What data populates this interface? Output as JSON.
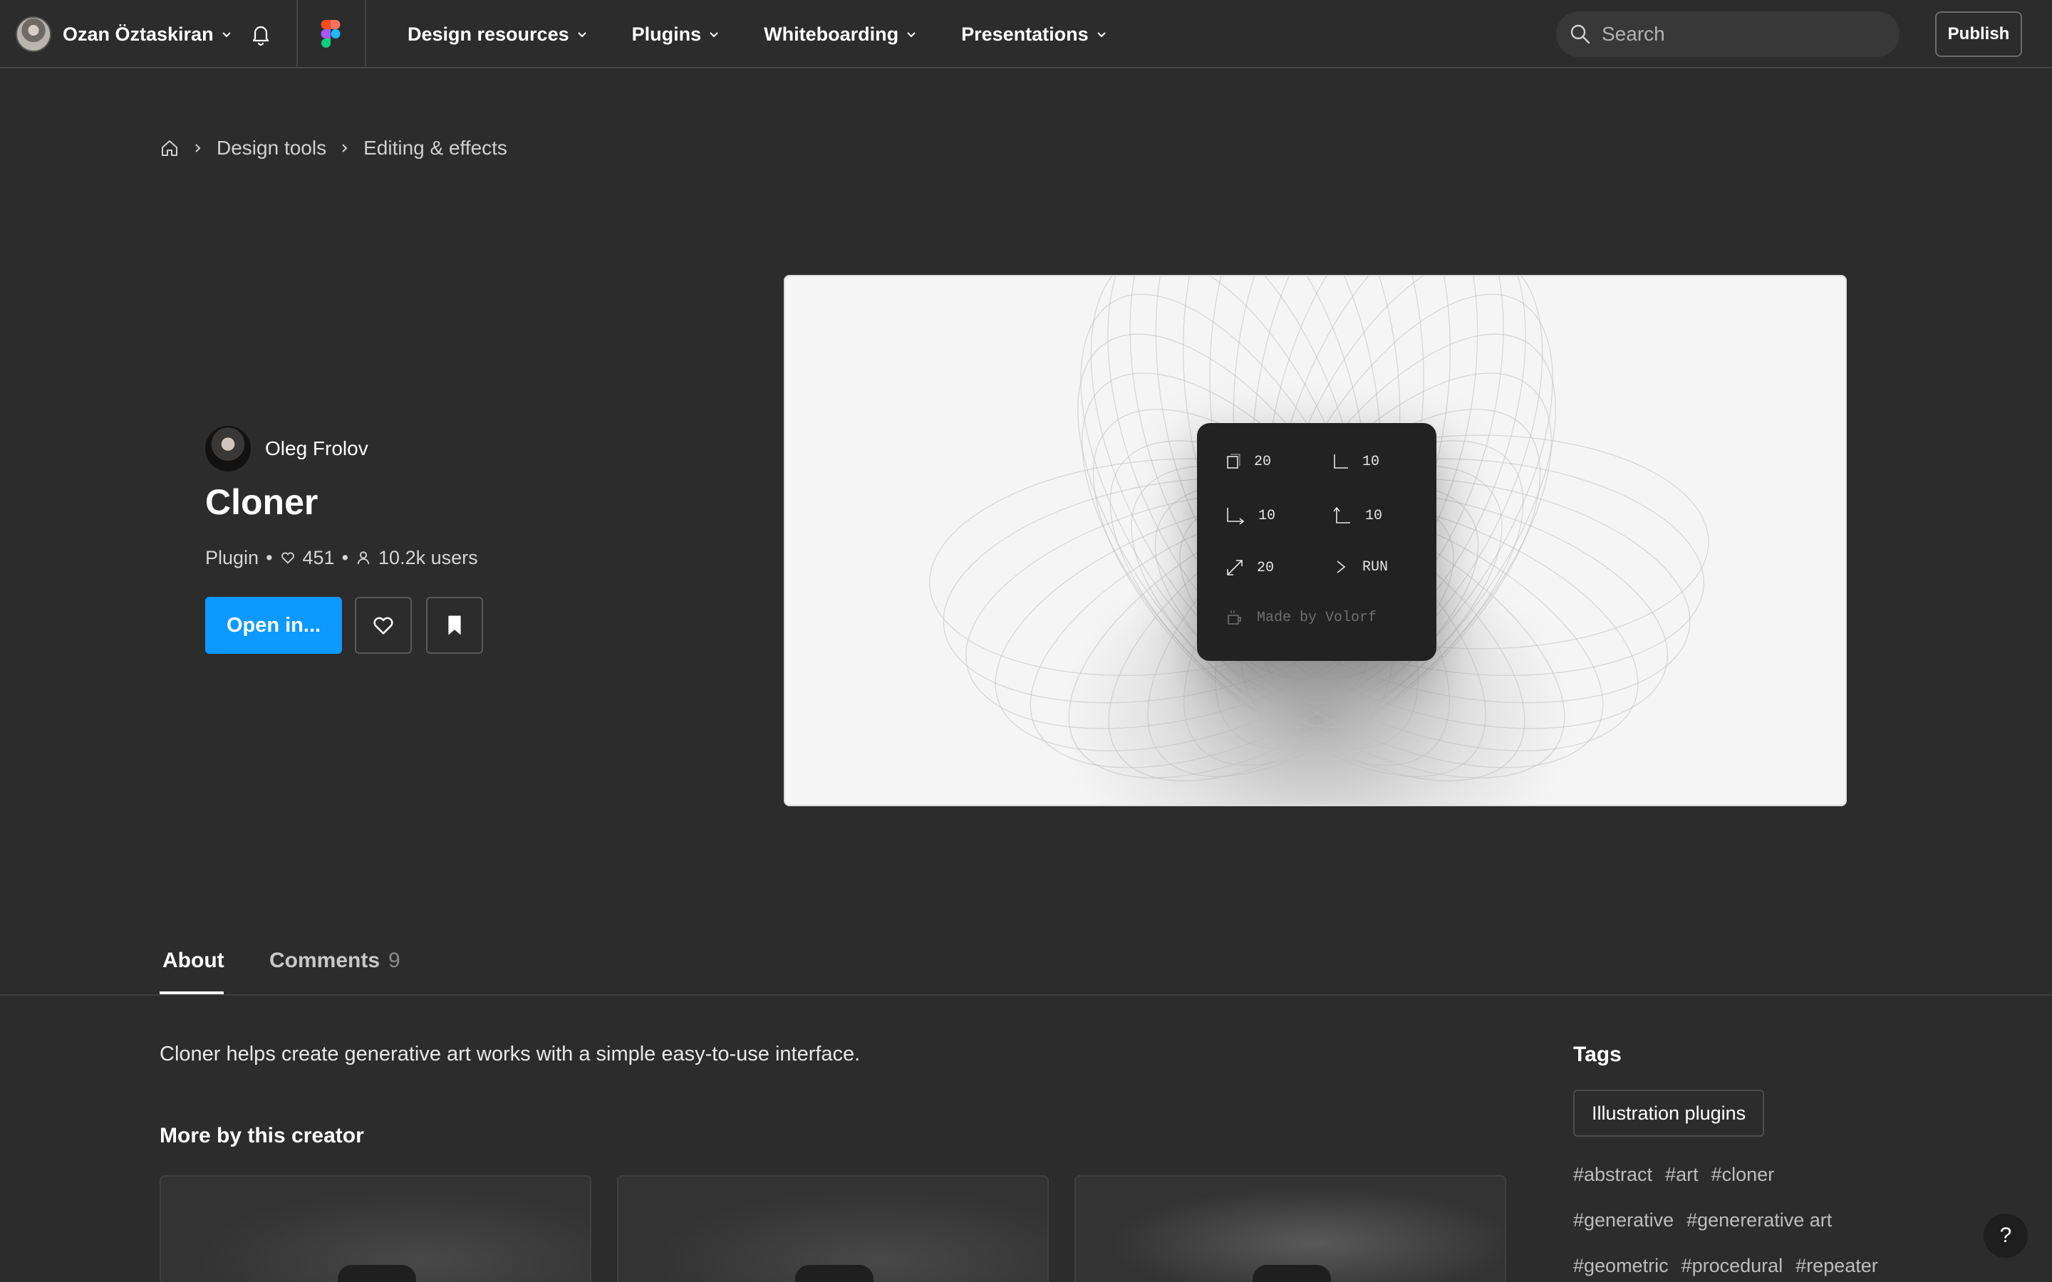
{
  "nav": {
    "user_name": "Ozan Öztaskiran",
    "menu": [
      "Design resources",
      "Plugins",
      "Whiteboarding",
      "Presentations"
    ],
    "search_placeholder": "Search",
    "publish_label": "Publish",
    "icons": {
      "notifications": "bell-icon",
      "logo": "figma-logo-icon",
      "search": "search-icon"
    }
  },
  "breadcrumb": [
    "Design tools",
    "Editing & effects"
  ],
  "plugin": {
    "creator": "Oleg Frolov",
    "title": "Cloner",
    "type": "Plugin",
    "likes": "451",
    "users": "10.2k users",
    "open_label": "Open in...",
    "accent": "#0d99ff"
  },
  "preview": {
    "controls": [
      "20",
      "10",
      "10",
      "10",
      "20",
      "RUN"
    ],
    "credit": "Made by Volorf"
  },
  "tabs": {
    "about": "About",
    "comments": "Comments",
    "comments_count": "9"
  },
  "about": {
    "description": "Cloner helps create generative art works with a simple easy-to-use interface.",
    "more_title": "More by this creator"
  },
  "tags": {
    "title": "Tags",
    "category": "Illustration plugins",
    "hashtags": [
      [
        "#abstract",
        "#art",
        "#cloner"
      ],
      [
        "#generative",
        "#genererative art"
      ],
      [
        "#geometric",
        "#procedural",
        "#repeater"
      ]
    ]
  },
  "help_label": "?"
}
